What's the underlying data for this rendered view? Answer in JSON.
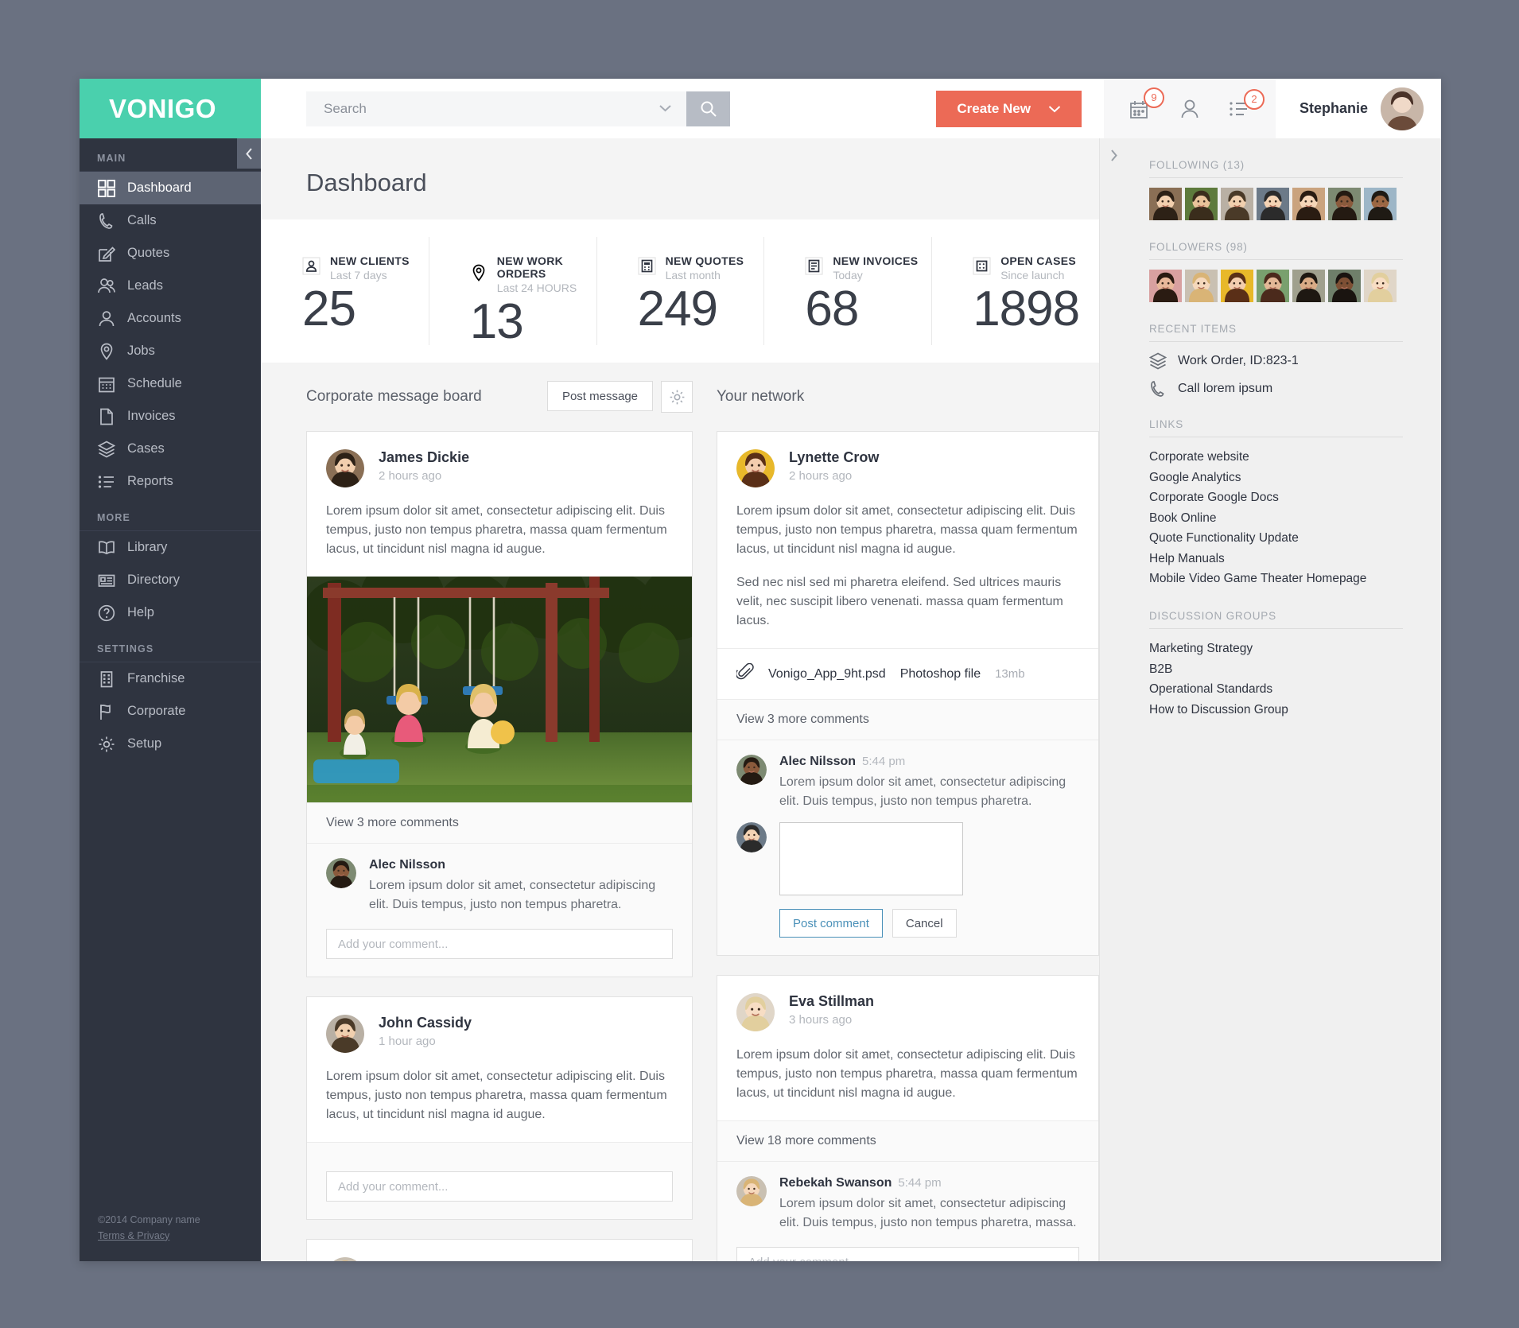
{
  "brand": {
    "logo": "VONIGO",
    "accent": "#4ad0ad",
    "cta": "#ec6a56"
  },
  "sidebar": {
    "sections": [
      {
        "label": "MAIN",
        "items": [
          {
            "label": "Dashboard",
            "icon": "grid-icon",
            "active": true
          },
          {
            "label": "Calls",
            "icon": "phone-icon"
          },
          {
            "label": "Quotes",
            "icon": "edit-square-icon"
          },
          {
            "label": "Leads",
            "icon": "users-icon"
          },
          {
            "label": "Accounts",
            "icon": "user-icon"
          },
          {
            "label": "Jobs",
            "icon": "map-pin-icon"
          },
          {
            "label": "Schedule",
            "icon": "calendar-icon"
          },
          {
            "label": "Invoices",
            "icon": "document-icon"
          },
          {
            "label": "Cases",
            "icon": "layers-icon"
          },
          {
            "label": "Reports",
            "icon": "list-icon"
          }
        ]
      },
      {
        "label": "MORE",
        "items": [
          {
            "label": "Library",
            "icon": "book-icon"
          },
          {
            "label": "Directory",
            "icon": "id-card-icon"
          },
          {
            "label": "Help",
            "icon": "question-circle-icon"
          }
        ]
      },
      {
        "label": "SETTINGS",
        "items": [
          {
            "label": "Franchise",
            "icon": "building-icon"
          },
          {
            "label": "Corporate",
            "icon": "flag-icon"
          },
          {
            "label": "Setup",
            "icon": "gear-icon"
          }
        ]
      }
    ],
    "footer": {
      "copyright": "©2014 Company name",
      "terms": "Terms & Privacy"
    }
  },
  "topbar": {
    "search_placeholder": "Search",
    "search_value": "",
    "create_label": "Create New",
    "calendar_badge": "9",
    "tasks_badge": "2",
    "user_name": "Stephanie"
  },
  "page": {
    "title": "Dashboard"
  },
  "kpis": [
    {
      "icon": "client-icon",
      "title": "NEW CLIENTS",
      "sub": "Last 7 days",
      "value": "25"
    },
    {
      "icon": "map-pin-icon",
      "title": "NEW WORK ORDERS",
      "sub": "Last 24 HOURS",
      "value": "13"
    },
    {
      "icon": "quote-icon",
      "title": "NEW QUOTES",
      "sub": "Last month",
      "value": "249"
    },
    {
      "icon": "invoice-icon",
      "title": "NEW INVOICES",
      "sub": "Today",
      "value": "68"
    },
    {
      "icon": "cases-icon",
      "title": "OPEN CASES",
      "sub": "Since launch",
      "value": "1898"
    }
  ],
  "message_board": {
    "title": "Corporate message board",
    "post_button": "Post message",
    "posts": [
      {
        "author": "James Dickie",
        "time": "2 hours ago",
        "body": "Lorem ipsum dolor sit amet, consectetur adipiscing elit. Duis tempus, justo non tempus pharetra, massa quam fermentum lacus, ut tincidunt nisl magna id augue.",
        "has_photo": true,
        "more_comments": "View 3 more comments",
        "comment": {
          "name": "Alec Nilsson",
          "text": "Lorem ipsum dolor sit amet, consectetur adipiscing elit. Duis tempus, justo non tempus pharetra."
        },
        "comment_placeholder": "Add your comment..."
      },
      {
        "author": "John Cassidy",
        "time": "1 hour ago",
        "body": "Lorem ipsum dolor sit amet, consectetur adipiscing elit. Duis tempus, justo non tempus pharetra, massa quam fermentum lacus, ut tincidunt nisl magna id augue.",
        "comment_placeholder": "Add your comment..."
      }
    ]
  },
  "network": {
    "title": "Your network",
    "posts": [
      {
        "author": "Lynette Crow",
        "time": "2 hours ago",
        "body1": "Lorem ipsum dolor sit amet, consectetur adipiscing elit. Duis tempus, justo non tempus pharetra, massa quam fermentum lacus, ut tincidunt nisl magna id augue.",
        "body2": "Sed nec nisl sed mi pharetra eleifend. Sed ultrices mauris velit, nec suscipit libero venenati. massa quam fermentum lacus.",
        "attachment": {
          "name": "Vonigo_App_9ht.psd",
          "type": "Photoshop file",
          "size": "13mb"
        },
        "more_comments": "View 3 more comments",
        "comment": {
          "name": "Alec Nilsson",
          "time": "5:44 pm",
          "text": "Lorem ipsum dolor sit amet, consectetur adipiscing elit. Duis tempus, justo non tempus pharetra."
        },
        "compose": {
          "value": "",
          "post_label": "Post comment",
          "cancel_label": "Cancel"
        }
      },
      {
        "author": "Eva Stillman",
        "time": "3 hours ago",
        "body1": "Lorem ipsum dolor sit amet, consectetur adipiscing elit. Duis tempus, justo non tempus pharetra, massa quam fermentum lacus, ut tincidunt nisl magna id augue.",
        "more_comments": "View 18 more comments",
        "comment": {
          "name": "Rebekah Swanson",
          "time": "5:44 pm",
          "text": "Lorem ipsum dolor sit amet, consectetur adipiscing elit. Duis tempus, justo non tempus pharetra, massa."
        },
        "comment_placeholder": "Add your comment..."
      }
    ]
  },
  "rightbar": {
    "following_label": "FOLLOWING (13)",
    "followers_label": "FOLLOWERS (98)",
    "recent_items_label": "RECENT ITEMS",
    "recent_items": [
      {
        "icon": "layers-icon",
        "label": "Work Order, ID:823-1"
      },
      {
        "icon": "phone-icon",
        "label": "Call lorem ipsum"
      }
    ],
    "links_label": "LINKS",
    "links": [
      "Corporate website",
      "Google Analytics",
      "Corporate Google Docs",
      "Book Online",
      "Quote Functionality Update",
      "Help Manuals",
      "Mobile Video Game Theater Homepage"
    ],
    "groups_label": "DISCUSSION GROUPS",
    "groups": [
      "Marketing Strategy",
      "B2B",
      "Operational Standards",
      "How to Discussion Group"
    ]
  }
}
